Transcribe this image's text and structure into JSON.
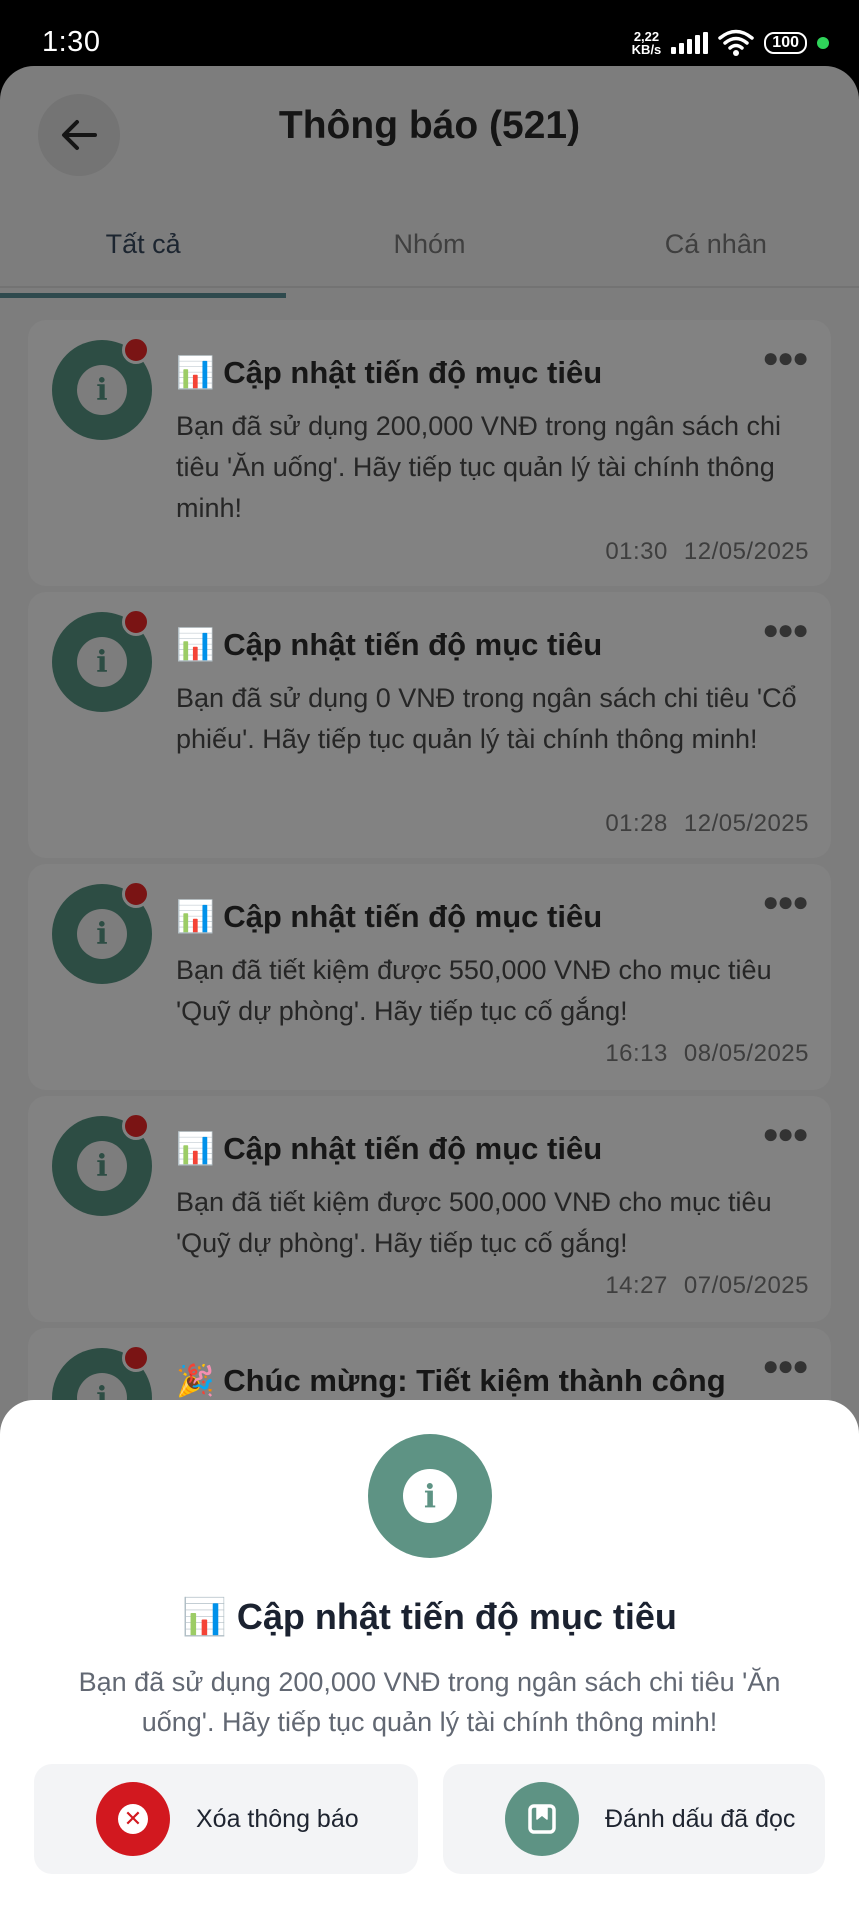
{
  "status_bar": {
    "time": "1:30",
    "net_speed_value": "2,22",
    "net_speed_unit": "KB/s",
    "battery": "100"
  },
  "header": {
    "title": "Thông báo (521)",
    "back_icon": "arrow-left-icon"
  },
  "tabs": [
    {
      "label": "Tất cả",
      "active": true
    },
    {
      "label": "Nhóm",
      "active": false
    },
    {
      "label": "Cá nhân",
      "active": false
    }
  ],
  "notifications": [
    {
      "emoji": "📊",
      "title": "Cập nhật tiến độ mục tiêu",
      "body": "Bạn đã sử dụng 200,000 VNĐ trong ngân sách chi tiêu 'Ăn uống'. Hãy tiếp tục quản lý tài chính thông minh!",
      "time": "01:30",
      "date": "12/05/2025",
      "unread": true
    },
    {
      "emoji": "📊",
      "title": "Cập nhật tiến độ mục tiêu",
      "body": "Bạn đã sử dụng 0 VNĐ trong ngân sách chi tiêu 'Cổ phiếu'. Hãy tiếp tục quản lý tài chính thông minh!",
      "time": "01:28",
      "date": "12/05/2025",
      "unread": true
    },
    {
      "emoji": "📊",
      "title": "Cập nhật tiến độ mục tiêu",
      "body": "Bạn đã tiết kiệm được 550,000 VNĐ cho mục tiêu 'Quỹ dự phòng'. Hãy tiếp tục cố gắng!",
      "time": "16:13",
      "date": "08/05/2025",
      "unread": true
    },
    {
      "emoji": "📊",
      "title": "Cập nhật tiến độ mục tiêu",
      "body": "Bạn đã tiết kiệm được 500,000 VNĐ cho mục tiêu 'Quỹ dự phòng'. Hãy tiếp tục cố gắng!",
      "time": "14:27",
      "date": "07/05/2025",
      "unread": true
    },
    {
      "emoji": "🎉",
      "title": "Chúc mừng: Tiết kiệm thành công",
      "unread": true
    }
  ],
  "sheet": {
    "emoji": "📊",
    "title": "Cập nhật tiến độ mục tiêu",
    "body": "Bạn đã sử dụng 200,000 VNĐ trong ngân sách chi tiêu 'Ăn uống'. Hãy tiếp tục quản lý tài chính thông minh!",
    "delete_label": "Xóa thông báo",
    "mark_read_label": "Đánh dấu đã đọc",
    "delete_color": "#d2181f",
    "accent_color": "#5e9384"
  }
}
